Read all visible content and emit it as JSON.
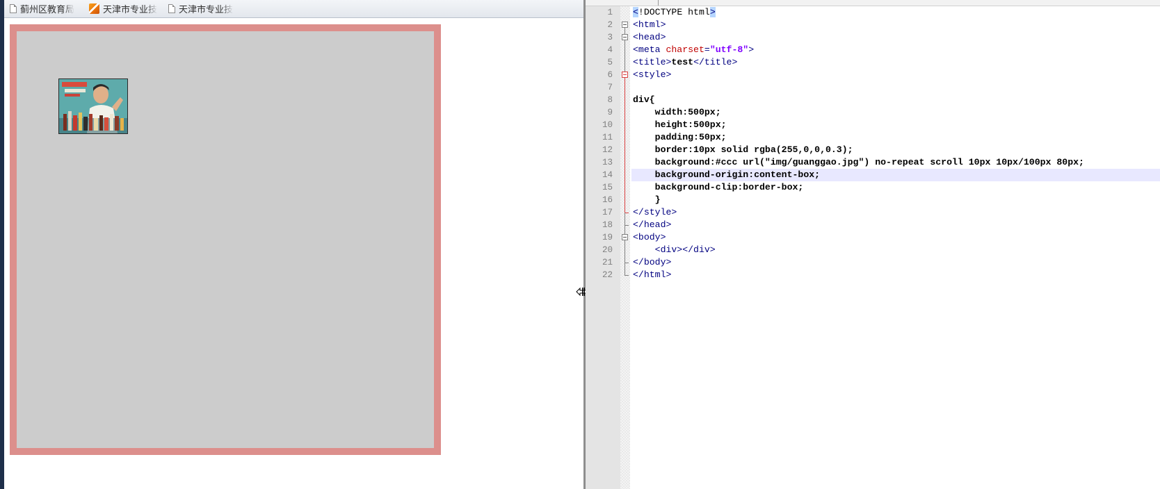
{
  "browser": {
    "bookmarks": [
      {
        "label": "蓟州区教育局",
        "icon": "page-icon"
      },
      {
        "label": "天津市专业技",
        "icon": "site-icon"
      },
      {
        "label": "天津市专业技",
        "icon": "page-icon"
      }
    ],
    "demo": {
      "border_color": "#dc8f8c",
      "background_color": "#cccccc",
      "image_alt": "guanggao.jpg"
    }
  },
  "editor": {
    "lines": [
      {
        "n": "1"
      },
      {
        "n": "2"
      },
      {
        "n": "3"
      },
      {
        "n": "4"
      },
      {
        "n": "5"
      },
      {
        "n": "6"
      },
      {
        "n": "7"
      },
      {
        "n": "8"
      },
      {
        "n": "9"
      },
      {
        "n": "10"
      },
      {
        "n": "11"
      },
      {
        "n": "12"
      },
      {
        "n": "13"
      },
      {
        "n": "14"
      },
      {
        "n": "15"
      },
      {
        "n": "16"
      },
      {
        "n": "17"
      },
      {
        "n": "18"
      },
      {
        "n": "19"
      },
      {
        "n": "20"
      },
      {
        "n": "21"
      },
      {
        "n": "22"
      }
    ],
    "code": {
      "l1_lt": "<",
      "l1_doctype": "!DOCTYPE html",
      "l1_gt": ">",
      "l2": "<html>",
      "l3": "<head>",
      "l4_open": "<meta ",
      "l4_attr": "charset",
      "l4_eq": "=",
      "l4_val": "\"utf-8\"",
      "l4_close": ">",
      "l5_open": "<title>",
      "l5_text": "test",
      "l5_close": "</title>",
      "l6": "<style>",
      "l7": "",
      "l8": "div{",
      "l9": "    width:500px;",
      "l10": "    height:500px;",
      "l11": "    padding:50px;",
      "l12": "    border:10px solid rgba(255,0,0,0.3);",
      "l13": "    background:#ccc url(\"img/guanggao.jpg\") no-repeat scroll 10px 10px/100px 80px;",
      "l14": "    background-origin:content-box;",
      "l15": "    background-clip:border-box;",
      "l16": "    }",
      "l17": "</style>",
      "l18": "</head>",
      "l19": "<body>",
      "l20": "    <div></div>",
      "l21": "</body>",
      "l22": "</html>"
    },
    "current_line": 14
  }
}
